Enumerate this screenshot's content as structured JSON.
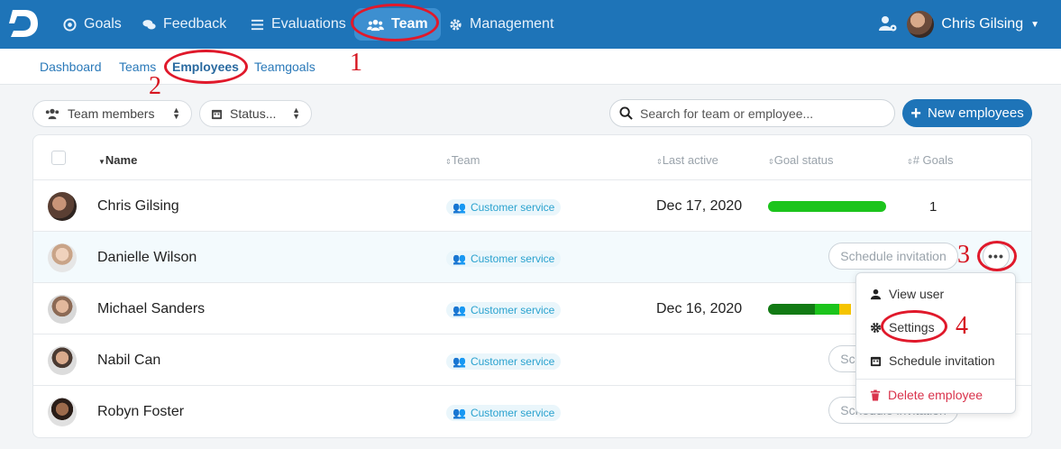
{
  "topnav": {
    "items": [
      {
        "label": "Goals",
        "icon": "target-icon"
      },
      {
        "label": "Feedback",
        "icon": "comments-icon"
      },
      {
        "label": "Evaluations",
        "icon": "list-icon"
      },
      {
        "label": "Team",
        "icon": "users-icon"
      },
      {
        "label": "Management",
        "icon": "gear-icon"
      }
    ],
    "active": "Team",
    "user_name": "Chris Gilsing"
  },
  "subnav": {
    "items": [
      "Dashboard",
      "Teams",
      "Employees",
      "Teamgoals"
    ],
    "active": "Employees"
  },
  "toolbar": {
    "filter_members": "Team members",
    "filter_status": "Status...",
    "search_placeholder": "Search for team or employee...",
    "new_button": "New employees"
  },
  "table": {
    "headers": {
      "name": "Name",
      "team": "Team",
      "last_active": "Last active",
      "goal_status": "Goal status",
      "goals": "# Goals"
    },
    "rows": [
      {
        "name": "Chris Gilsing",
        "team": "Customer service",
        "last_active": "Dec 17, 2020",
        "goal_status": [
          1.0,
          0,
          0
        ],
        "goals": "1"
      },
      {
        "name": "Danielle Wilson",
        "team": "Customer service",
        "last_active": "",
        "invite": "Schedule invitation"
      },
      {
        "name": "Michael Sanders",
        "team": "Customer service",
        "last_active": "Dec 16, 2020",
        "goal_status": [
          0.4,
          0.2,
          0.1
        ]
      },
      {
        "name": "Nabil Can",
        "team": "Customer service",
        "last_active": "",
        "invite": "Schedule invitation"
      },
      {
        "name": "Robyn Foster",
        "team": "Customer service",
        "last_active": "",
        "invite": "Schedule invitation"
      }
    ]
  },
  "dropdown": {
    "view_user": "View user",
    "settings": "Settings",
    "schedule": "Schedule invitation",
    "delete": "Delete employee"
  },
  "annotations": {
    "n1": "1",
    "n2": "2",
    "n3": "3",
    "n4": "4"
  },
  "colors": {
    "brand": "#1e74b8",
    "goal_green": "#1cc41c",
    "goal_dark": "#127a14",
    "goal_yellow": "#f5c400",
    "danger": "#d9334c",
    "annotation": "#e0192b"
  }
}
